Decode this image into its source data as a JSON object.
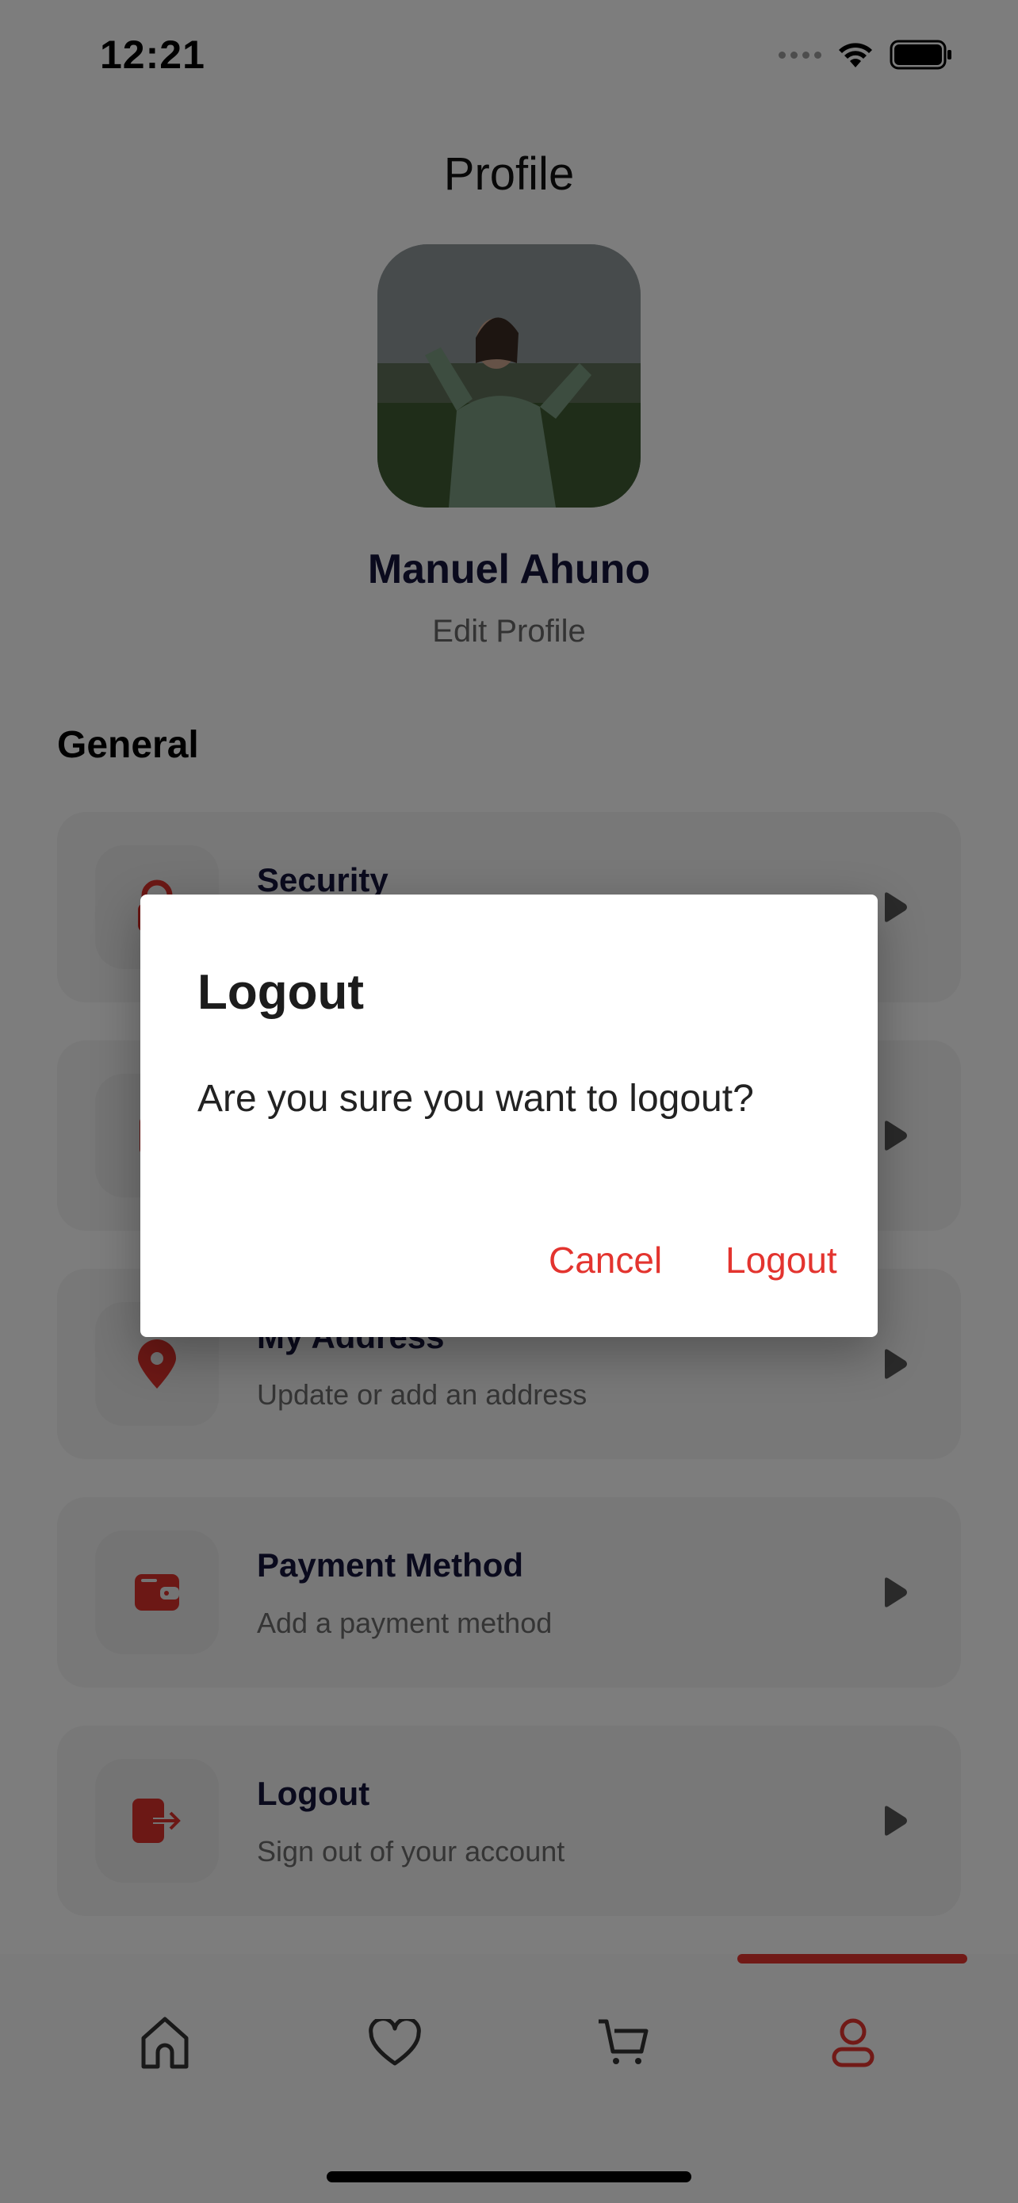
{
  "status_bar": {
    "time": "12:21"
  },
  "header": {
    "title": "Profile"
  },
  "profile": {
    "name": "Manuel Ahuno",
    "edit_label": "Edit Profile"
  },
  "general": {
    "title": "General",
    "items": [
      {
        "title": "Security",
        "subtitle": "",
        "icon": "lock-icon"
      },
      {
        "title": "",
        "subtitle": "",
        "icon": "bell-icon"
      },
      {
        "title": "My Address",
        "subtitle": "Update or add an address",
        "icon": "location-pin-icon"
      },
      {
        "title": "Payment Method",
        "subtitle": "Add a payment method",
        "icon": "wallet-icon"
      },
      {
        "title": "Logout",
        "subtitle": "Sign out of your account",
        "icon": "logout-icon"
      }
    ]
  },
  "bottom_nav": {
    "items": [
      "home-icon",
      "heart-icon",
      "cart-icon",
      "profile-icon"
    ],
    "active": "profile-icon"
  },
  "dialog": {
    "title": "Logout",
    "message": "Are you sure you want to logout?",
    "cancel_label": "Cancel",
    "confirm_label": "Logout"
  },
  "colors": {
    "accent": "#e3342f",
    "text_dark": "#14143a",
    "overlay": "rgba(0,0,0,0.5)"
  }
}
